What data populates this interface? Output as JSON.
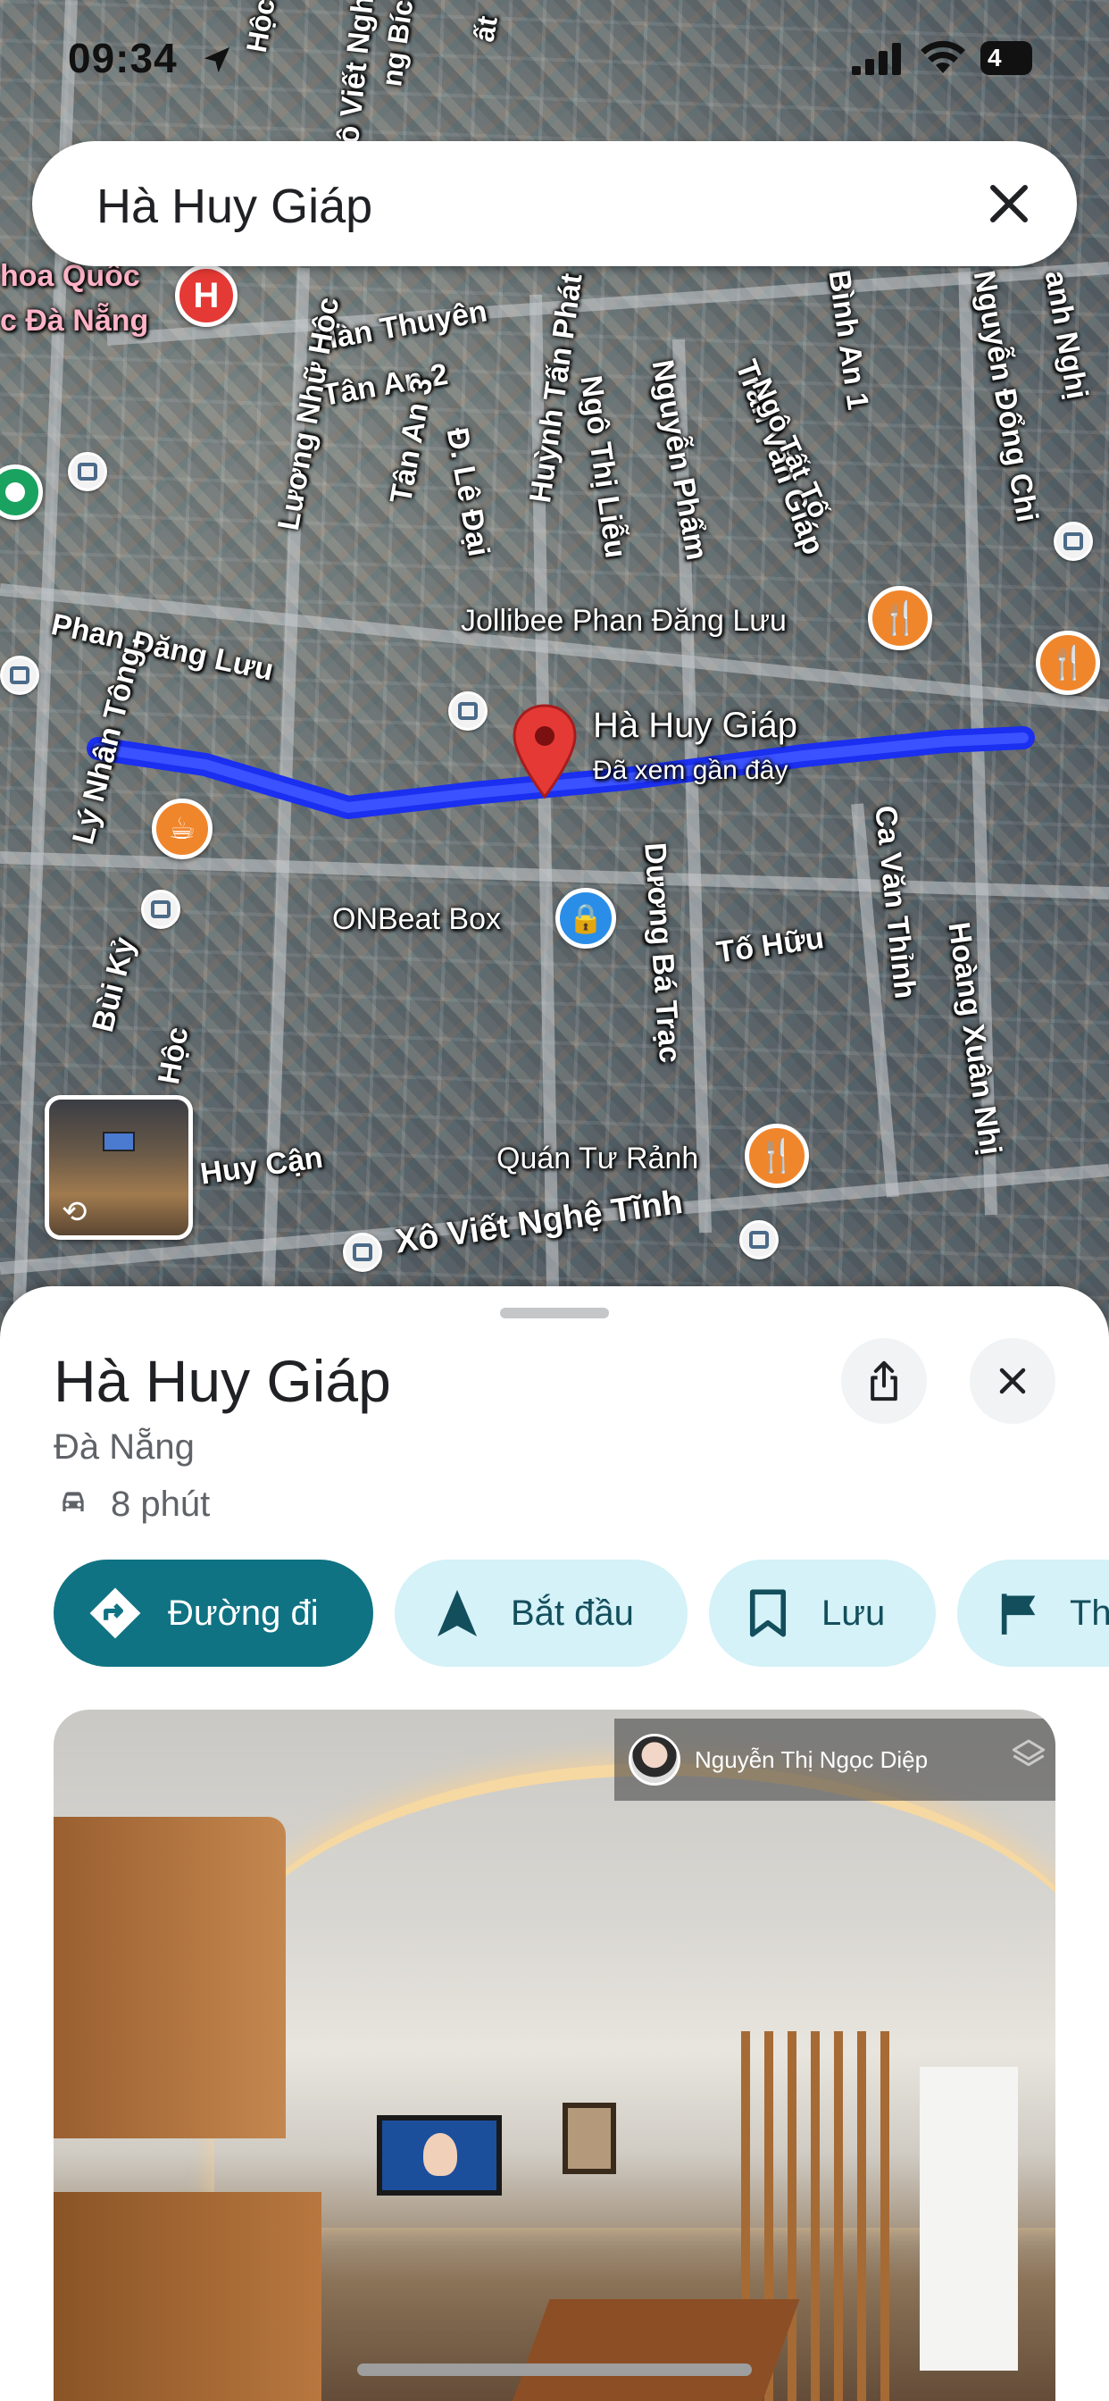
{
  "status_bar": {
    "time": "09:34",
    "battery": "4"
  },
  "search": {
    "query": "Hà Huy Giáp"
  },
  "map": {
    "streets": [
      "Hàn Thuyên",
      "Tân An 2",
      "Tân An 3",
      "Đ. Lê Đại",
      "Ngô Thị Liễu",
      "Nguyễn Phẩm",
      "Trần Văn Giáp",
      "Ngô Tất Tố",
      "Bình An 1",
      "Nguyễn Đổng Chi",
      "Phan Đăng Lưu",
      "Lý Nhân Tông",
      "Lương Nhữ Hộc",
      "Huỳnh Tấn Phát",
      "Dương Bá Trạc",
      "Tố Hữu",
      "Ca Văn Thỉnh",
      "Hoàng Xuân Nhị",
      "Bùi Kỷ",
      "Huy Cận",
      "Xô Viết Nghệ Tĩnh",
      "Hộc",
      "ng Bích",
      "ất",
      "anh Nghị",
      "Hộc"
    ],
    "places": {
      "hospital": "hoa Quốc",
      "hospital_line2": "c Đà Nẵng",
      "jollibee": "Jollibee Phan Đăng Lưu",
      "onbeat": "ONBeat Box",
      "quan": "Quán Tư Rảnh"
    },
    "pin": {
      "title": "Hà Huy Giáp",
      "subtitle": "Đã xem gần đây"
    },
    "colors": {
      "route": "#1a2ff0",
      "pin": "#e53935"
    }
  },
  "sheet": {
    "title": "Hà Huy Giáp",
    "city": "Đà Nẵng",
    "drive_time": "8 phút",
    "chips": {
      "directions": "Đường đi",
      "start": "Bắt đầu",
      "save": "Lưu",
      "more": "Th"
    },
    "photo": {
      "author": "Nguyễn Thị Ngọc Diệp"
    },
    "colors": {
      "primary": "#0f7383",
      "chip_bg": "#d4f2f8"
    }
  }
}
